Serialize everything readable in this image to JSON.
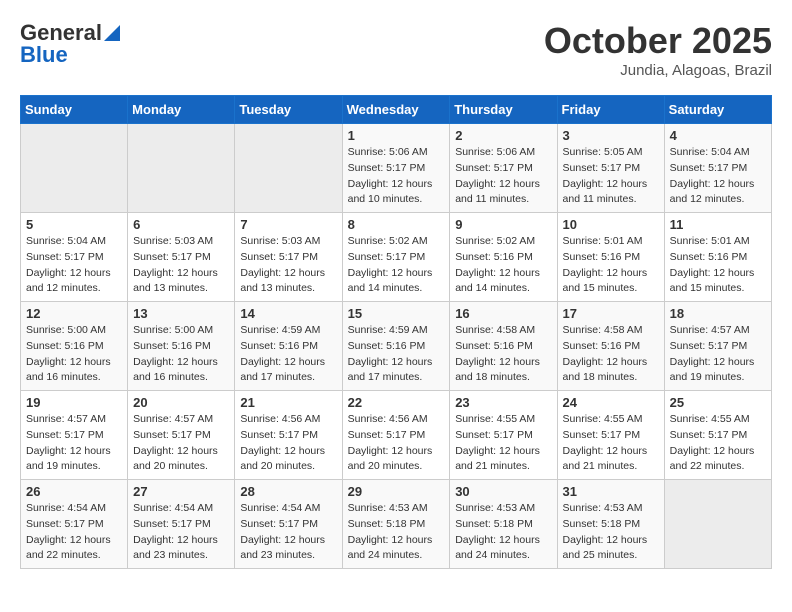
{
  "header": {
    "logo_line1": "General",
    "logo_line2": "Blue",
    "month": "October 2025",
    "location": "Jundia, Alagoas, Brazil"
  },
  "days_of_week": [
    "Sunday",
    "Monday",
    "Tuesday",
    "Wednesday",
    "Thursday",
    "Friday",
    "Saturday"
  ],
  "weeks": [
    [
      {
        "day": "",
        "info": ""
      },
      {
        "day": "",
        "info": ""
      },
      {
        "day": "",
        "info": ""
      },
      {
        "day": "1",
        "info": "Sunrise: 5:06 AM\nSunset: 5:17 PM\nDaylight: 12 hours\nand 10 minutes."
      },
      {
        "day": "2",
        "info": "Sunrise: 5:06 AM\nSunset: 5:17 PM\nDaylight: 12 hours\nand 11 minutes."
      },
      {
        "day": "3",
        "info": "Sunrise: 5:05 AM\nSunset: 5:17 PM\nDaylight: 12 hours\nand 11 minutes."
      },
      {
        "day": "4",
        "info": "Sunrise: 5:04 AM\nSunset: 5:17 PM\nDaylight: 12 hours\nand 12 minutes."
      }
    ],
    [
      {
        "day": "5",
        "info": "Sunrise: 5:04 AM\nSunset: 5:17 PM\nDaylight: 12 hours\nand 12 minutes."
      },
      {
        "day": "6",
        "info": "Sunrise: 5:03 AM\nSunset: 5:17 PM\nDaylight: 12 hours\nand 13 minutes."
      },
      {
        "day": "7",
        "info": "Sunrise: 5:03 AM\nSunset: 5:17 PM\nDaylight: 12 hours\nand 13 minutes."
      },
      {
        "day": "8",
        "info": "Sunrise: 5:02 AM\nSunset: 5:17 PM\nDaylight: 12 hours\nand 14 minutes."
      },
      {
        "day": "9",
        "info": "Sunrise: 5:02 AM\nSunset: 5:16 PM\nDaylight: 12 hours\nand 14 minutes."
      },
      {
        "day": "10",
        "info": "Sunrise: 5:01 AM\nSunset: 5:16 PM\nDaylight: 12 hours\nand 15 minutes."
      },
      {
        "day": "11",
        "info": "Sunrise: 5:01 AM\nSunset: 5:16 PM\nDaylight: 12 hours\nand 15 minutes."
      }
    ],
    [
      {
        "day": "12",
        "info": "Sunrise: 5:00 AM\nSunset: 5:16 PM\nDaylight: 12 hours\nand 16 minutes."
      },
      {
        "day": "13",
        "info": "Sunrise: 5:00 AM\nSunset: 5:16 PM\nDaylight: 12 hours\nand 16 minutes."
      },
      {
        "day": "14",
        "info": "Sunrise: 4:59 AM\nSunset: 5:16 PM\nDaylight: 12 hours\nand 17 minutes."
      },
      {
        "day": "15",
        "info": "Sunrise: 4:59 AM\nSunset: 5:16 PM\nDaylight: 12 hours\nand 17 minutes."
      },
      {
        "day": "16",
        "info": "Sunrise: 4:58 AM\nSunset: 5:16 PM\nDaylight: 12 hours\nand 18 minutes."
      },
      {
        "day": "17",
        "info": "Sunrise: 4:58 AM\nSunset: 5:16 PM\nDaylight: 12 hours\nand 18 minutes."
      },
      {
        "day": "18",
        "info": "Sunrise: 4:57 AM\nSunset: 5:17 PM\nDaylight: 12 hours\nand 19 minutes."
      }
    ],
    [
      {
        "day": "19",
        "info": "Sunrise: 4:57 AM\nSunset: 5:17 PM\nDaylight: 12 hours\nand 19 minutes."
      },
      {
        "day": "20",
        "info": "Sunrise: 4:57 AM\nSunset: 5:17 PM\nDaylight: 12 hours\nand 20 minutes."
      },
      {
        "day": "21",
        "info": "Sunrise: 4:56 AM\nSunset: 5:17 PM\nDaylight: 12 hours\nand 20 minutes."
      },
      {
        "day": "22",
        "info": "Sunrise: 4:56 AM\nSunset: 5:17 PM\nDaylight: 12 hours\nand 20 minutes."
      },
      {
        "day": "23",
        "info": "Sunrise: 4:55 AM\nSunset: 5:17 PM\nDaylight: 12 hours\nand 21 minutes."
      },
      {
        "day": "24",
        "info": "Sunrise: 4:55 AM\nSunset: 5:17 PM\nDaylight: 12 hours\nand 21 minutes."
      },
      {
        "day": "25",
        "info": "Sunrise: 4:55 AM\nSunset: 5:17 PM\nDaylight: 12 hours\nand 22 minutes."
      }
    ],
    [
      {
        "day": "26",
        "info": "Sunrise: 4:54 AM\nSunset: 5:17 PM\nDaylight: 12 hours\nand 22 minutes."
      },
      {
        "day": "27",
        "info": "Sunrise: 4:54 AM\nSunset: 5:17 PM\nDaylight: 12 hours\nand 23 minutes."
      },
      {
        "day": "28",
        "info": "Sunrise: 4:54 AM\nSunset: 5:17 PM\nDaylight: 12 hours\nand 23 minutes."
      },
      {
        "day": "29",
        "info": "Sunrise: 4:53 AM\nSunset: 5:18 PM\nDaylight: 12 hours\nand 24 minutes."
      },
      {
        "day": "30",
        "info": "Sunrise: 4:53 AM\nSunset: 5:18 PM\nDaylight: 12 hours\nand 24 minutes."
      },
      {
        "day": "31",
        "info": "Sunrise: 4:53 AM\nSunset: 5:18 PM\nDaylight: 12 hours\nand 25 minutes."
      },
      {
        "day": "",
        "info": ""
      }
    ]
  ]
}
